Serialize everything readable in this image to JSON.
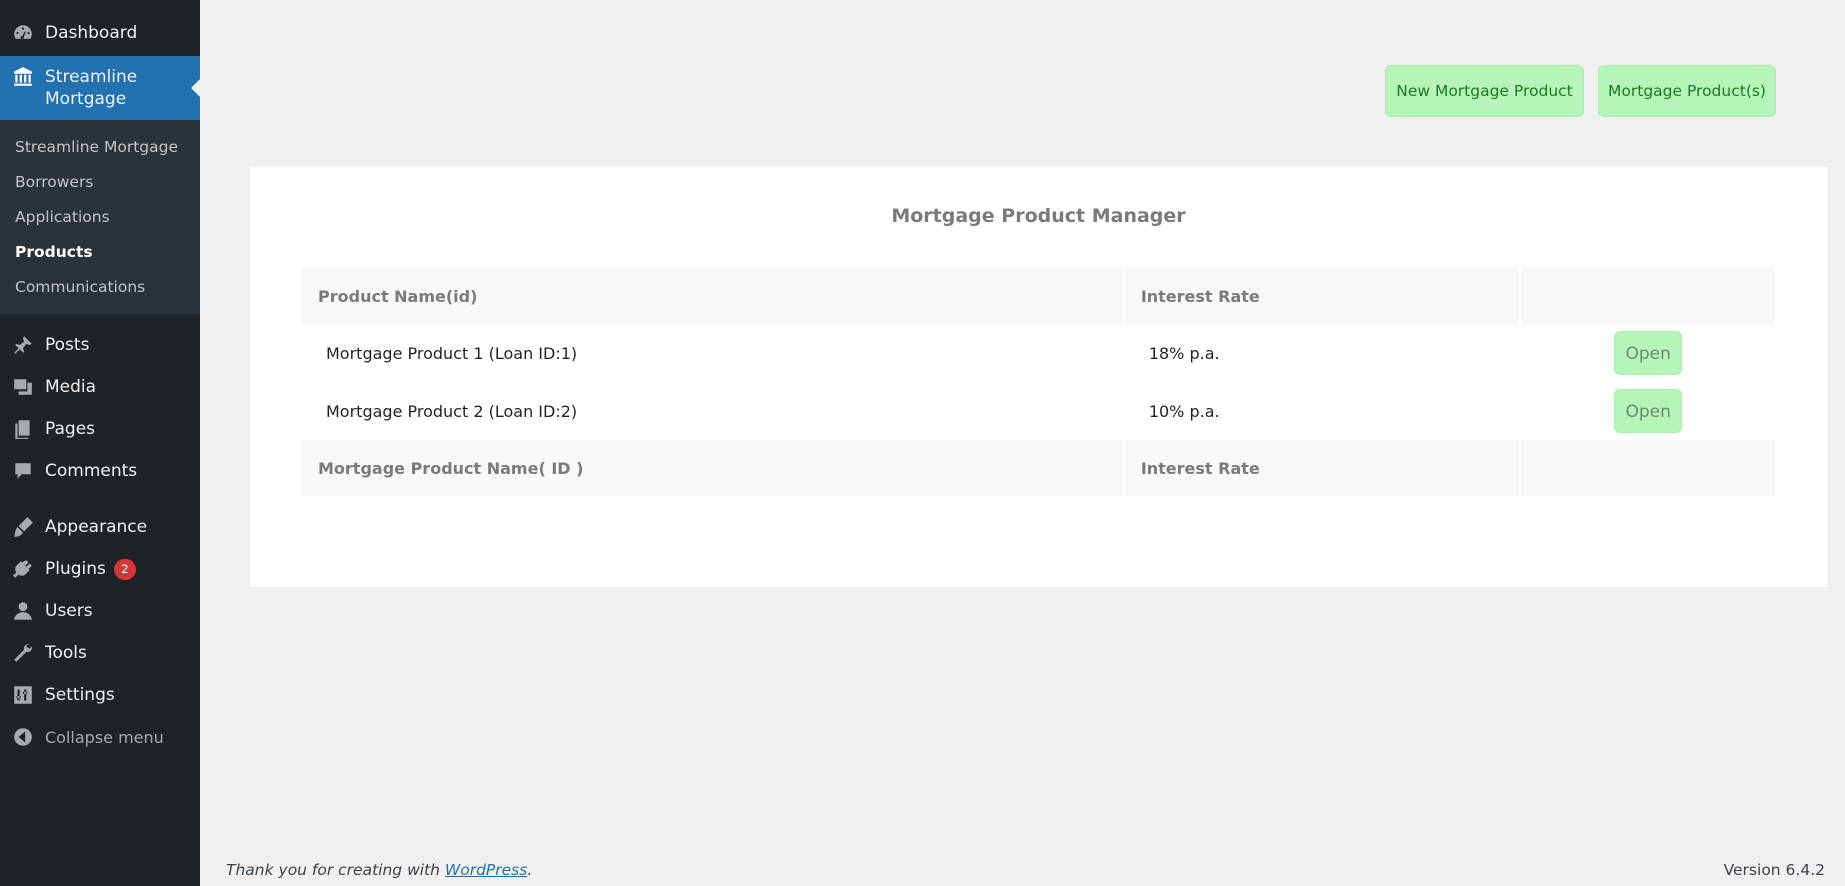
{
  "sidebar": {
    "dashboard": "Dashboard",
    "active": "Streamline Mortgage",
    "submenu": [
      "Streamline Mortgage",
      "Borrowers",
      "Applications",
      "Products",
      "Communications"
    ],
    "posts": "Posts",
    "media": "Media",
    "pages": "Pages",
    "comments": "Comments",
    "appearance": "Appearance",
    "plugins": "Plugins",
    "plugins_badge": "2",
    "users": "Users",
    "tools": "Tools",
    "settings": "Settings",
    "collapse": "Collapse menu"
  },
  "toolbar": {
    "new_product": "New Mortgage Product",
    "product_list": "Mortgage Product(s)"
  },
  "panel": {
    "title": "Mortgage Product Manager",
    "header": {
      "name": "Product Name(id)",
      "rate": "Interest Rate"
    },
    "rows": [
      {
        "name": "Mortgage Product 1 (Loan ID:1)",
        "rate": "18% p.a.",
        "action": "Open"
      },
      {
        "name": "Mortgage Product 2 (Loan ID:2)",
        "rate": "10% p.a.",
        "action": "Open"
      }
    ],
    "footer": {
      "name": "Mortgage Product Name( ID )",
      "rate": "Interest Rate"
    }
  },
  "footer": {
    "thanks_prefix": "Thank you for creating with ",
    "link": "WordPress",
    "thanks_suffix": ".",
    "version": "Version 6.4.2"
  },
  "colors": {
    "sidebar_bg": "#1d2327",
    "active_bg": "#2271b1",
    "button_green": "#b6f5b9"
  }
}
